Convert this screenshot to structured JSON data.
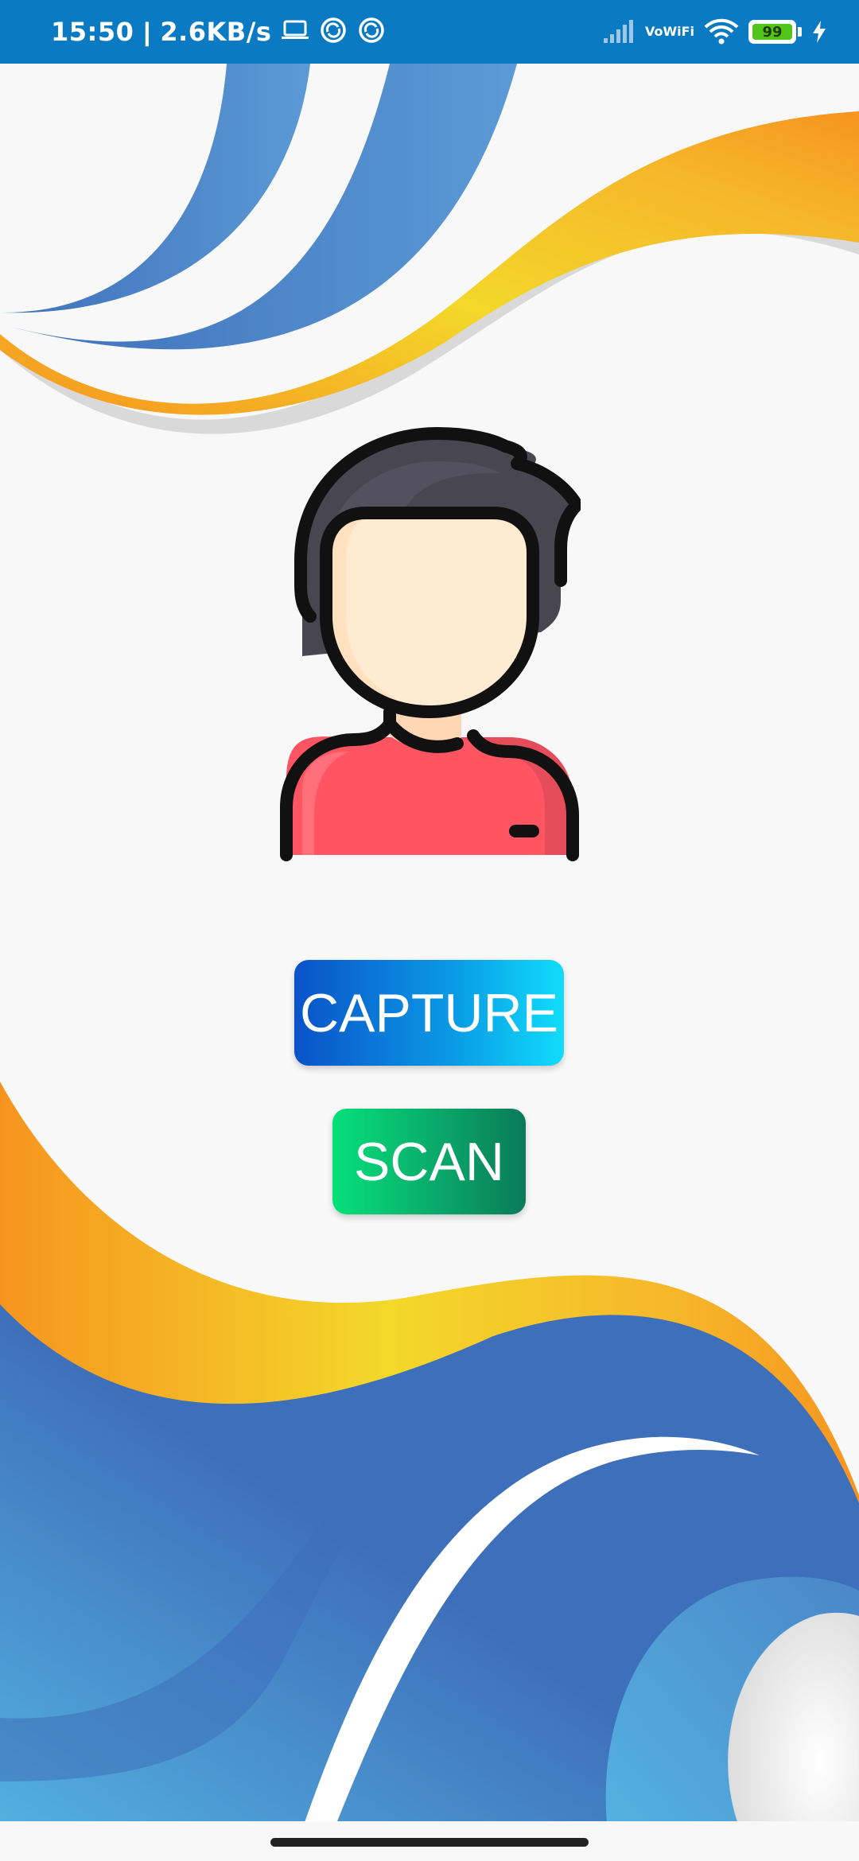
{
  "status_bar": {
    "time": "15:50",
    "separator": "|",
    "network_speed": "2.6KB/s",
    "left_icons": [
      "laptop-icon",
      "sync-icon",
      "sync-icon"
    ],
    "vowifi_top": "Vo",
    "vowifi_bottom": "WiFi",
    "battery_level": "99",
    "battery_percent": 99,
    "charging": true,
    "background": "#0a7ac2"
  },
  "buttons": {
    "capture_label": "CAPTURE",
    "scan_label": "SCAN"
  },
  "colors": {
    "capture_gradient": [
      "#0a52c8",
      "#10dcfa"
    ],
    "scan_gradient": [
      "#06e07a",
      "#0a7a58"
    ],
    "wave_blue": "#3e6fba",
    "wave_orange": "#f6941f",
    "wave_yellow": "#f3d82a",
    "avatar_shirt": "#ff5563",
    "avatar_hair": "#474651",
    "avatar_face": "#ffebd2"
  }
}
